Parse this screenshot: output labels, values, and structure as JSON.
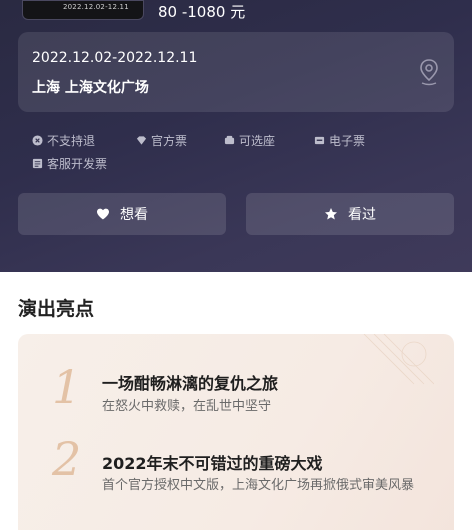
{
  "header": {
    "poster_caption": "2022.12.02-12.11",
    "price": "80 -1080 元"
  },
  "venue": {
    "date_range": "2022.12.02-2022.12.11",
    "place": "上海  上海文化广场"
  },
  "tags": [
    {
      "label": "不支持退",
      "icon": "close-circle-icon"
    },
    {
      "label": "官方票",
      "icon": "diamond-icon"
    },
    {
      "label": "可选座",
      "icon": "seat-icon"
    },
    {
      "label": "电子票",
      "icon": "ticket-icon"
    },
    {
      "label": "客服开发票",
      "icon": "invoice-icon"
    }
  ],
  "actions": {
    "want_label": "想看",
    "seen_label": "看过"
  },
  "highlights": {
    "title": "演出亮点",
    "items": [
      {
        "num": "1",
        "title": "一场酣畅淋漓的复仇之旅",
        "desc": "在怒火中救赎，在乱世中坚守"
      },
      {
        "num": "2",
        "title": "2022年末不可错过的重磅大戏",
        "desc": "首个官方授权中文版，上海文化广场再掀俄式审美风暴"
      }
    ]
  },
  "colors": {
    "hero_bg": "#2f2e4c",
    "accent_number": "#e3c2a6",
    "card_bg": "#f6ebe4"
  }
}
